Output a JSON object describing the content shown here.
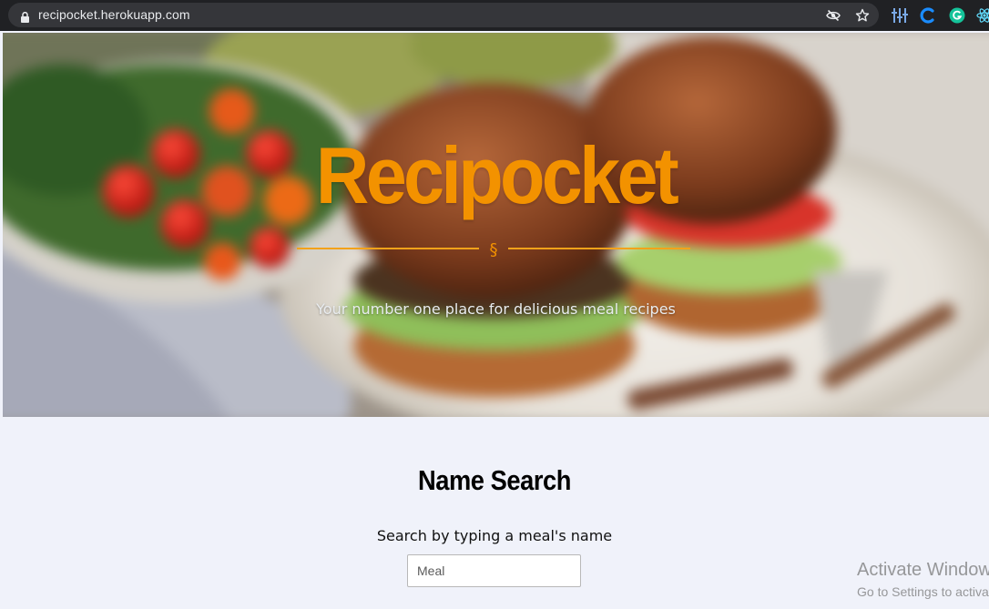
{
  "browser": {
    "url": "recipocket.herokuapp.com",
    "icons": {
      "lock": "lock-icon",
      "tracking": "eye-off-icon",
      "bookmark": "star-icon",
      "extension_1": "bars-extension-icon",
      "extension_2": "c-extension-icon",
      "extension_3": "grammarly-icon",
      "extension_4": "react-devtools-icon"
    }
  },
  "hero": {
    "title": "Recipocket",
    "divider_glyph": "§",
    "subtitle": "Your number one place for delicious meal recipes",
    "accent_color": "#f39200"
  },
  "search": {
    "heading": "Name Search",
    "label": "Search by typing a meal's name",
    "input_placeholder": "Meal",
    "input_value": ""
  },
  "watermark": {
    "title": "Activate Windows",
    "subtitle": "Go to Settings to activate Windows."
  }
}
